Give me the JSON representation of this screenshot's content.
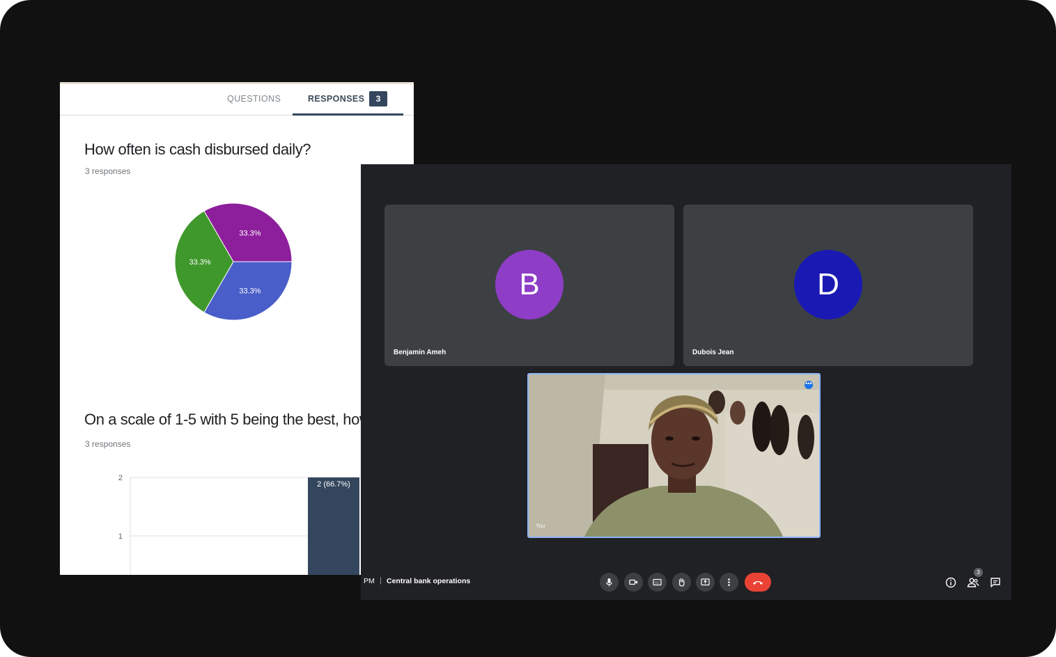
{
  "forms": {
    "tabs": {
      "questions": "QUESTIONS",
      "responses": "RESPONSES",
      "responses_count": "3"
    },
    "questions": [
      {
        "title": "How often is cash disbursed daily?",
        "responses": "3 responses"
      },
      {
        "title": "On a scale of 1-5 with 5 being the best, how",
        "responses": "3 responses"
      }
    ]
  },
  "chart_data": [
    {
      "type": "pie",
      "slices": [
        {
          "value": 33.3,
          "label": "33.3%",
          "color": "#8e1f9c"
        },
        {
          "value": 33.3,
          "label": "33.3%",
          "color": "#4a5ec9"
        },
        {
          "value": 33.3,
          "label": "33.3%",
          "color": "#3f982b"
        }
      ]
    },
    {
      "type": "bar",
      "ylim": [
        0,
        2
      ],
      "yticks": [
        "2",
        "1"
      ],
      "bars": [
        {
          "value": 2,
          "label": "2 (66.7%)",
          "color": "#34465e"
        }
      ]
    }
  ],
  "meet": {
    "participants": [
      {
        "initial": "B",
        "name": "Benjamin Ameh",
        "color": "#8e3dc7"
      },
      {
        "initial": "D",
        "name": "Dubois Jean",
        "color": "#1b19b3"
      }
    ],
    "self": {
      "label": "You",
      "more": "•••"
    },
    "bottom": {
      "time": "PM",
      "separator": "|",
      "meeting_name": "Central bank operations",
      "people_count": "3"
    },
    "controls": [
      "mic-icon",
      "camera-icon",
      "captions-icon",
      "raise-hand-icon",
      "present-icon",
      "more-options-icon",
      "end-call-icon"
    ],
    "right_icons": [
      "info-icon",
      "people-icon",
      "chat-icon"
    ]
  }
}
